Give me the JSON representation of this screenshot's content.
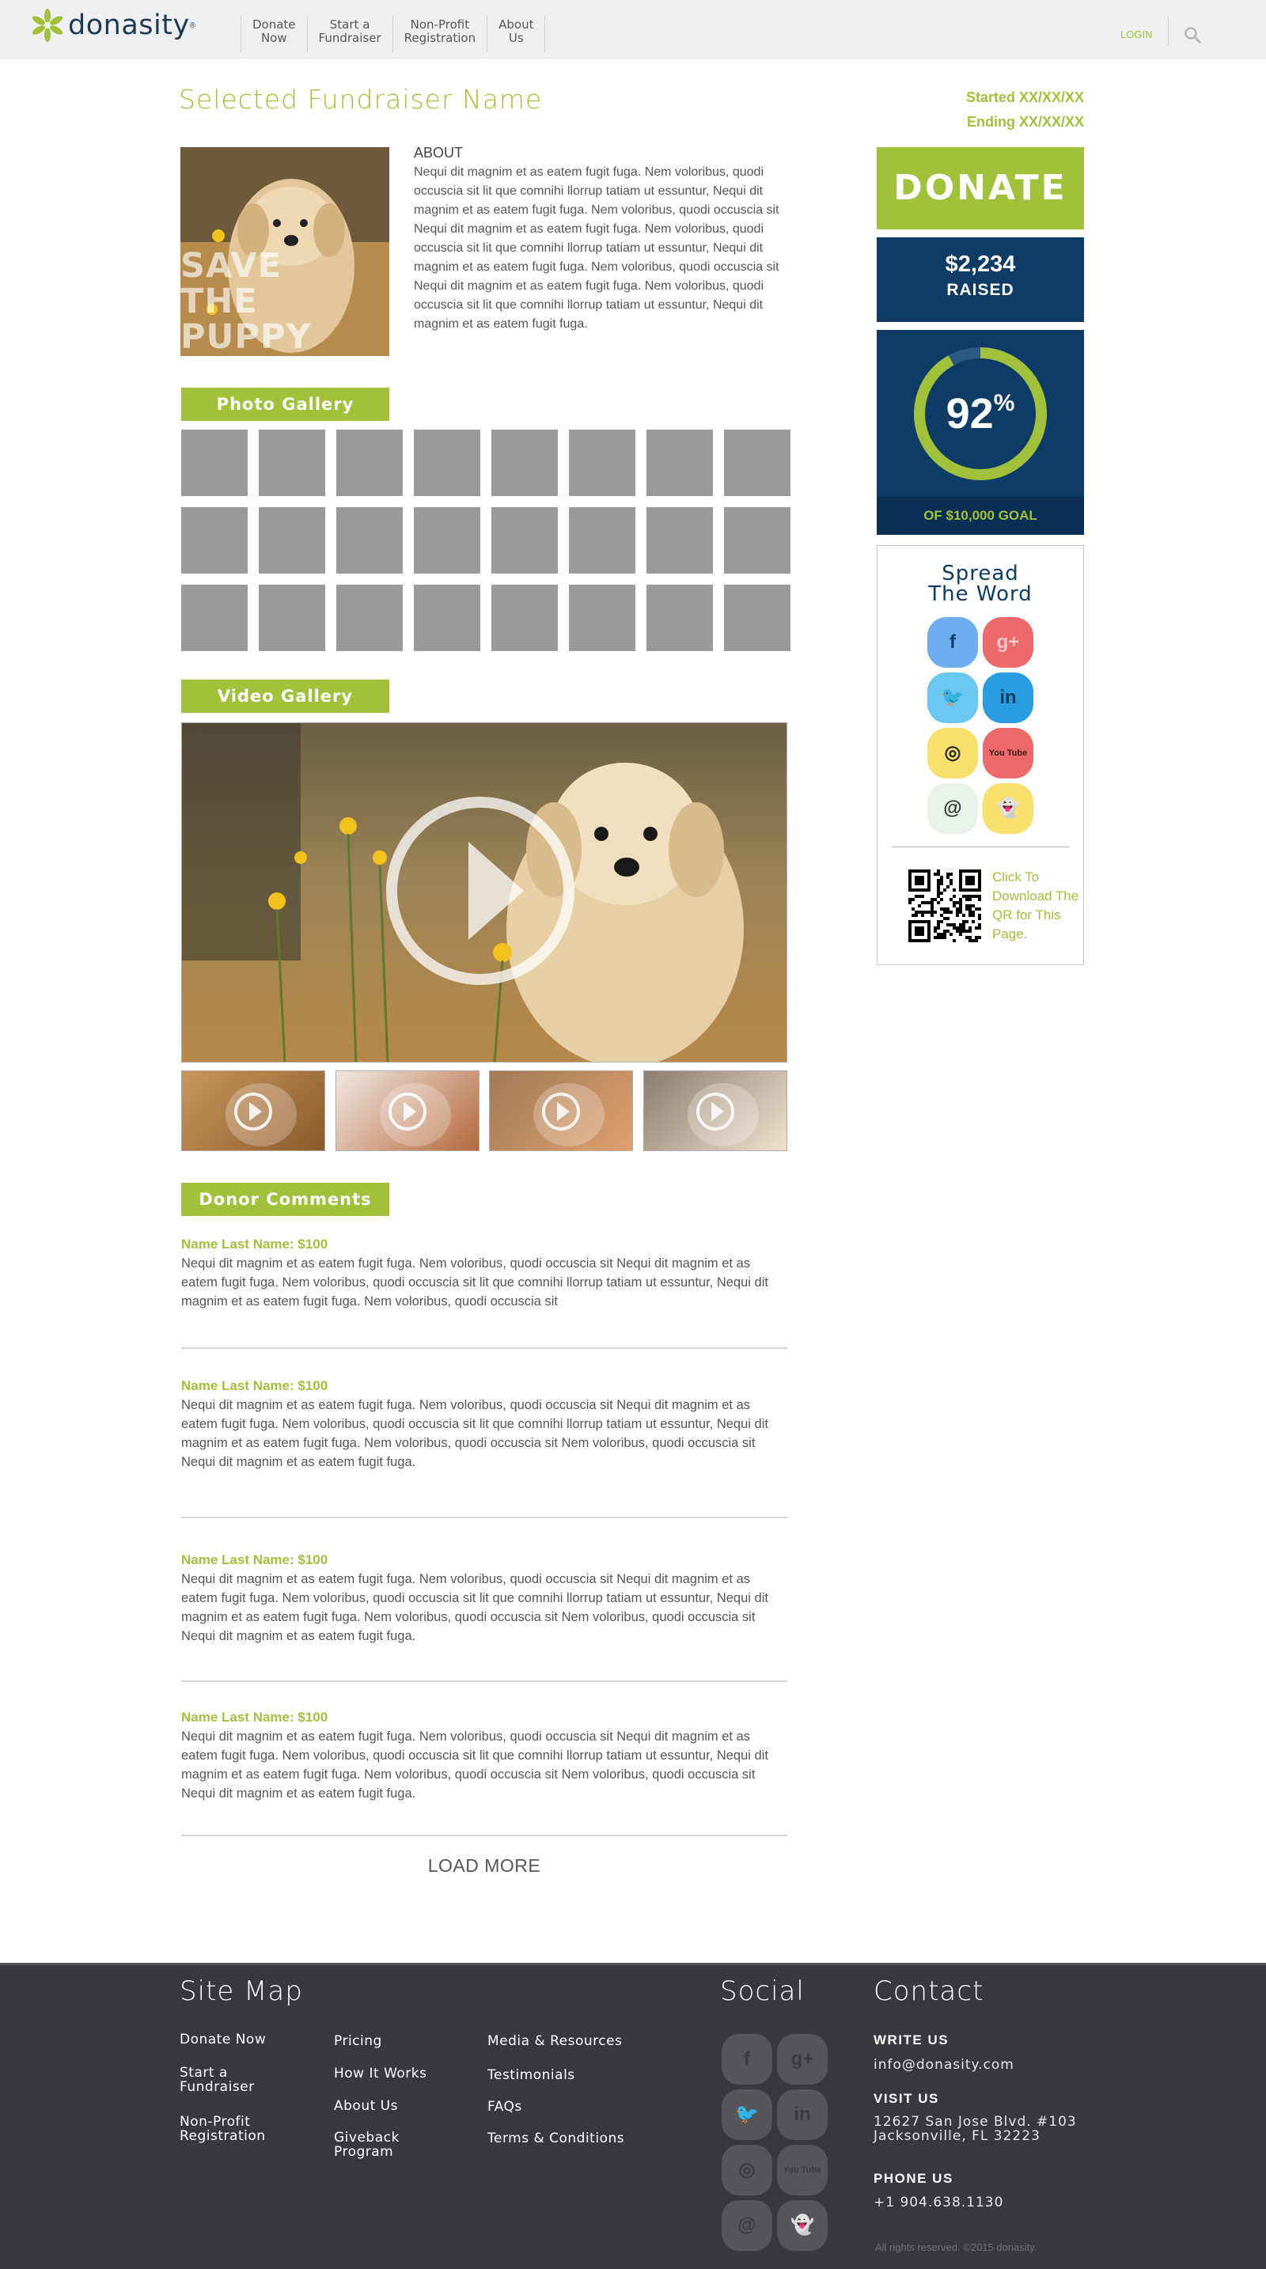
{
  "header": {
    "brand": "donasity",
    "trademark": "®",
    "nav": [
      {
        "label": "Donate\nNow",
        "name": "nav-donate-now"
      },
      {
        "label": "Start a\nFundraiser",
        "name": "nav-start-fundraiser"
      },
      {
        "label": "Non-Profit\nRegistration",
        "name": "nav-nonprofit-registration"
      },
      {
        "label": "About\nUs",
        "name": "nav-about-us"
      }
    ],
    "login": "LOGIN",
    "search_icon": "search-icon"
  },
  "fundraiser": {
    "title": "Selected Fundraiser Name",
    "started": "Started XX/XX/XX",
    "ending": "Ending XX/XX/XX",
    "hero_text": "SAVE\nTHE\nPUPPY",
    "about_heading": "ABOUT",
    "about_body": "Nequi dit magnim et as eatem fugit fuga. Nem voloribus, quodi occuscia sit lit que comnihi llorrup tatiam ut essuntur, Nequi dit magnim et as eatem fugit fuga. Nem voloribus, quodi occuscia sit Nequi dit magnim et as eatem fugit fuga. Nem voloribus, quodi occuscia sit lit que comnihi llorrup tatiam ut essuntur, Nequi dit magnim et as eatem fugit fuga. Nem voloribus, quodi occuscia sit Nequi dit magnim et as eatem fugit fuga. Nem voloribus, quodi occuscia sit lit que comnihi llorrup tatiam ut essuntur, Nequi dit magnim et as eatem fugit fuga."
  },
  "sections": {
    "photo_gallery": "Photo Gallery",
    "video_gallery": "Video Gallery",
    "donor_comments": "Donor Comments"
  },
  "photo_gallery": {
    "count": 24
  },
  "video_thumbs": 4,
  "comments": [
    {
      "name": "Name Last Name: $100",
      "text": "Nequi dit magnim et as eatem fugit fuga. Nem voloribus, quodi occuscia sit Nequi dit magnim et as eatem fugit fuga. Nem voloribus, quodi occuscia sit lit que comnihi llorrup tatiam ut essuntur, Nequi dit magnim et as eatem fugit fuga. Nem voloribus, quodi occuscia sit"
    },
    {
      "name": "Name Last Name: $100",
      "text": "Nequi dit magnim et as eatem fugit fuga. Nem voloribus, quodi occuscia sit Nequi dit magnim et as eatem fugit fuga. Nem voloribus, quodi occuscia sit lit que comnihi llorrup tatiam ut essuntur, Nequi dit magnim et as eatem fugit fuga. Nem voloribus, quodi occuscia sit Nem voloribus, quodi occuscia sit Nequi dit magnim et as eatem fugit fuga."
    },
    {
      "name": "Name Last Name: $100",
      "text": "Nequi dit magnim et as eatem fugit fuga. Nem voloribus, quodi occuscia sit Nequi dit magnim et as eatem fugit fuga. Nem voloribus, quodi occuscia sit lit que comnihi llorrup tatiam ut essuntur, Nequi dit magnim et as eatem fugit fuga. Nem voloribus, quodi occuscia sit Nem voloribus, quodi occuscia sit Nequi dit magnim et as eatem fugit fuga."
    },
    {
      "name": "Name Last Name: $100",
      "text": "Nequi dit magnim et as eatem fugit fuga. Nem voloribus, quodi occuscia sit Nequi dit magnim et as eatem fugit fuga. Nem voloribus, quodi occuscia sit lit que comnihi llorrup tatiam ut essuntur, Nequi dit magnim et as eatem fugit fuga. Nem voloribus, quodi occuscia sit Nem voloribus, quodi occuscia sit Nequi dit magnim et as eatem fugit fuga."
    }
  ],
  "load_more": "LOAD MORE",
  "sidebar": {
    "donate_label": "DONATE",
    "raised_amount": "$2,234",
    "raised_label": "RAISED",
    "progress": {
      "percent": 92,
      "value": "92",
      "unit": "%",
      "goal_label": "OF $10,000 GOAL"
    },
    "spread_title": "Spread\nThe Word",
    "social": [
      {
        "icon": "facebook-icon",
        "glyph": "f",
        "bg": "#6faef0",
        "fg": "#0e3c66"
      },
      {
        "icon": "google-plus-icon",
        "glyph": "g+",
        "bg": "#ec6a6c",
        "fg": "#f3c8c8"
      },
      {
        "icon": "twitter-icon",
        "glyph": "🐦",
        "bg": "#6ac7ef",
        "fg": "#0e3c66"
      },
      {
        "icon": "linkedin-icon",
        "glyph": "in",
        "bg": "#2a9ce0",
        "fg": "#0e3c66"
      },
      {
        "icon": "instagram-icon",
        "glyph": "◎",
        "bg": "#f8e06c",
        "fg": "#2b2b2b"
      },
      {
        "icon": "youtube-icon",
        "glyph": "You Tube",
        "bg": "#ec6a6c",
        "fg": "#3b1a1a"
      },
      {
        "icon": "email-icon",
        "glyph": "@",
        "bg": "#e8f2ea",
        "fg": "#333"
      },
      {
        "icon": "snapchat-icon",
        "glyph": "👻",
        "bg": "#f8e06c",
        "fg": "#2b2b2b"
      }
    ],
    "qr_text": "Click To Download The QR for This Page."
  },
  "footer": {
    "sitemap_heading": "Site Map",
    "col1": [
      "Donate Now",
      "Start a\nFundraiser",
      "Non-Profit\nRegistration"
    ],
    "col2": [
      "Pricing",
      "How It Works",
      "About Us",
      "Giveback\nProgram"
    ],
    "col3": [
      "Media & Resources",
      "Testimonials",
      "FAQs",
      "Terms & Conditions"
    ],
    "social_heading": "Social",
    "social": [
      {
        "icon": "facebook-icon",
        "glyph": "f"
      },
      {
        "icon": "google-plus-icon",
        "glyph": "g+"
      },
      {
        "icon": "twitter-icon",
        "glyph": "🐦"
      },
      {
        "icon": "linkedin-icon",
        "glyph": "in"
      },
      {
        "icon": "instagram-icon",
        "glyph": "◎"
      },
      {
        "icon": "youtube-icon",
        "glyph": "You Tube"
      },
      {
        "icon": "email-icon",
        "glyph": "@"
      },
      {
        "icon": "snapchat-icon",
        "glyph": "👻"
      }
    ],
    "contact_heading": "Contact",
    "write_us_label": "WRITE US",
    "email": "info@donasity.com",
    "visit_us_label": "VISIT US",
    "address": "12627 San Jose Blvd. #103\nJacksonville, FL 32223",
    "phone_label": "PHONE US",
    "phone": "+1 904.638.1130",
    "copyright": "All rights reserved. ©2015 donasity."
  },
  "colors": {
    "accent": "#a2c13b",
    "navy": "#0e3c66",
    "footer": "#38393d"
  }
}
